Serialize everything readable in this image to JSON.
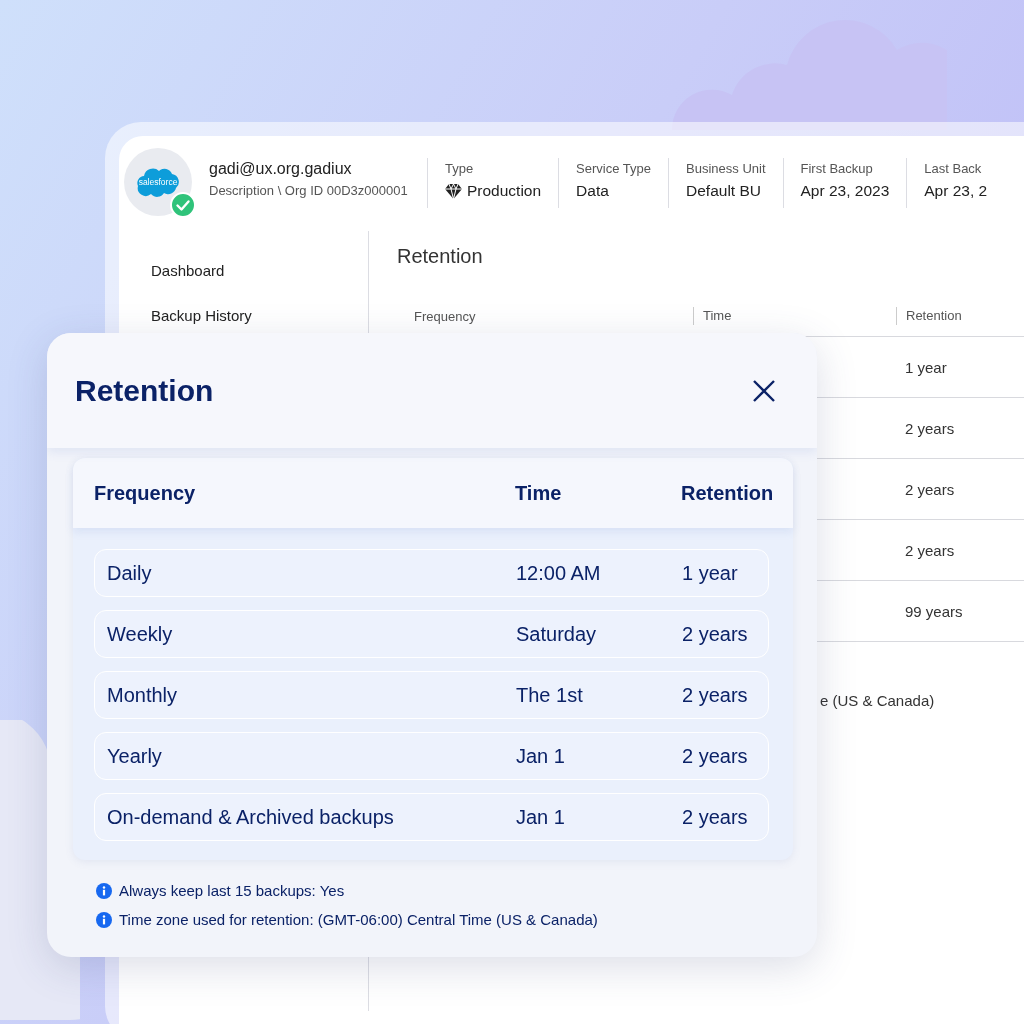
{
  "account": {
    "logo_text": "salesforce",
    "verified": true,
    "email": "gadi@ux.org.gadiux",
    "description": "Description \\ Org ID 00D3z000001"
  },
  "details": [
    {
      "kind": "icon_value",
      "label": "Type",
      "value": "Production"
    },
    {
      "kind": "text",
      "label": "Service Type",
      "value": "Data"
    },
    {
      "kind": "text",
      "label": "Business Unit",
      "value": "Default BU"
    },
    {
      "kind": "text",
      "label": "First Backup",
      "value": "Apr 23, 2023"
    },
    {
      "kind": "text",
      "label": "Last Back",
      "value": "Apr 23, 2"
    }
  ],
  "sidebar": {
    "items": [
      "Dashboard",
      "Backup History"
    ]
  },
  "retention_page": {
    "title": "Retention",
    "columns": [
      "Frequency",
      "Time",
      "Retention"
    ],
    "rows": [
      {
        "retention": "1 year"
      },
      {
        "retention": "2 years"
      },
      {
        "retention": "2 years"
      },
      {
        "retention": "2 years"
      },
      {
        "retention": "99 years"
      }
    ],
    "note": "e (US & Canada)"
  },
  "dialog": {
    "title": "Retention",
    "columns": [
      "Frequency",
      "Time",
      "Retention"
    ],
    "rows": [
      {
        "frequency": "Daily",
        "time": "12:00 AM",
        "retention": "1 year"
      },
      {
        "frequency": "Weekly",
        "time": "Saturday",
        "retention": "2 years"
      },
      {
        "frequency": "Monthly",
        "time": "The 1st",
        "retention": "2 years"
      },
      {
        "frequency": "Yearly",
        "time": "Jan 1",
        "retention": "2 years"
      },
      {
        "frequency": "On-demand & Archived backups",
        "time": "Jan 1",
        "retention": "2 years"
      }
    ],
    "notes": [
      "Always keep last 15 backups: Yes",
      "Time zone used for retention: (GMT-06:00) Central Time (US & Canada)"
    ]
  }
}
